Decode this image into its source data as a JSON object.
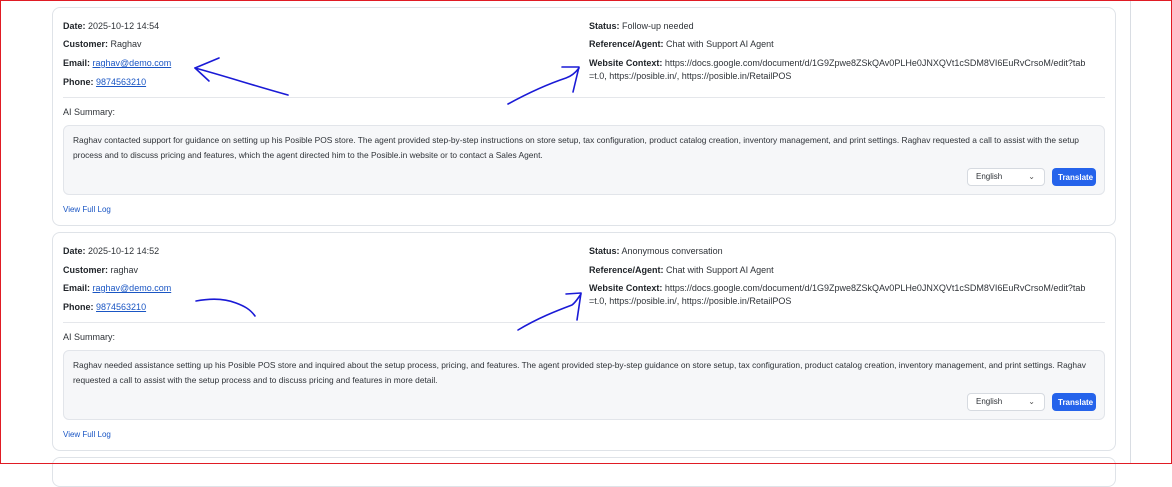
{
  "labels": {
    "date": "Date:",
    "customer": "Customer:",
    "email": "Email:",
    "phone": "Phone:",
    "status": "Status:",
    "reference_agent": "Reference/Agent:",
    "website_context": "Website Context:",
    "ai_summary": "AI Summary:",
    "view_full_log": "View Full Log",
    "translate": "Translate"
  },
  "records": [
    {
      "date": "2025-10-12 14:54",
      "customer": "Raghav",
      "email": "raghav@demo.com",
      "phone": "9874563210",
      "status": "Follow-up needed",
      "reference_agent": "Chat with Support AI Agent",
      "website_context": "https://docs.google.com/document/d/1G9Zpwe8ZSkQAv0PLHe0JNXQVt1cSDM8VI6EuRvCrsoM/edit?tab=t.0, https://posible.in/, https://posible.in/RetailPOS",
      "summary": "Raghav contacted support for guidance on setting up his Posible POS store. The agent provided step-by-step instructions on store setup, tax configuration, product catalog creation, inventory management, and print settings. Raghav requested a call to assist with the setup process and to discuss pricing and features, which the agent directed him to the Posible.in website or to contact a Sales Agent.",
      "language": "English"
    },
    {
      "date": "2025-10-12 14:52",
      "customer": "raghav",
      "email": "raghav@demo.com",
      "phone": "9874563210",
      "status": "Anonymous conversation",
      "reference_agent": "Chat with Support AI Agent",
      "website_context": "https://docs.google.com/document/d/1G9Zpwe8ZSkQAv0PLHe0JNXQVt1cSDM8VI6EuRvCrsoM/edit?tab=t.0, https://posible.in/, https://posible.in/RetailPOS",
      "summary": "Raghav needed assistance setting up his Posible POS store and inquired about the setup process, pricing, and features. The agent provided step-by-step guidance on store setup, tax configuration, product catalog creation, inventory management, and print settings. Raghav requested a call to assist with the setup process and to discuss pricing and features in more detail.",
      "language": "English"
    }
  ],
  "colors": {
    "accent": "#2563eb",
    "link": "#1a56c4",
    "annotation_ink": "#1a1ad6",
    "frame_border": "#e01b24"
  }
}
